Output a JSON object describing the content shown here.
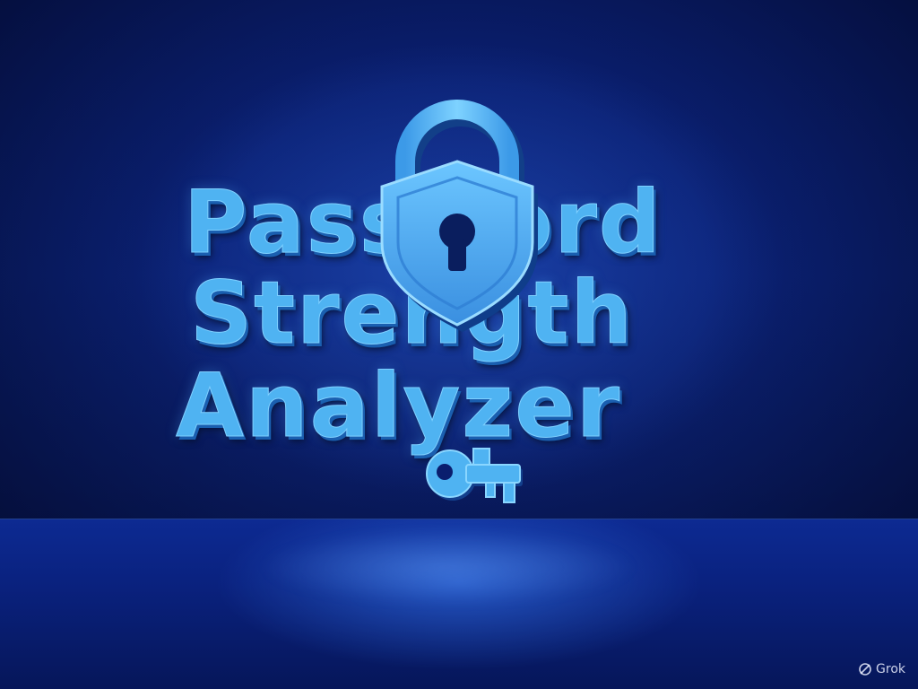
{
  "title": {
    "line1": "Password",
    "line2": "Strength",
    "line3": "Analyzer"
  },
  "icons": {
    "lock": "padlock-shield-icon",
    "key": "key-icon",
    "watermark": "grok-logo-icon"
  },
  "watermark": {
    "text": "Grok"
  },
  "colors": {
    "background": "#0a1e6e",
    "accent": "#4fb3f2",
    "accent_dark": "#1a5fb0",
    "floor": "#0d2a92"
  }
}
